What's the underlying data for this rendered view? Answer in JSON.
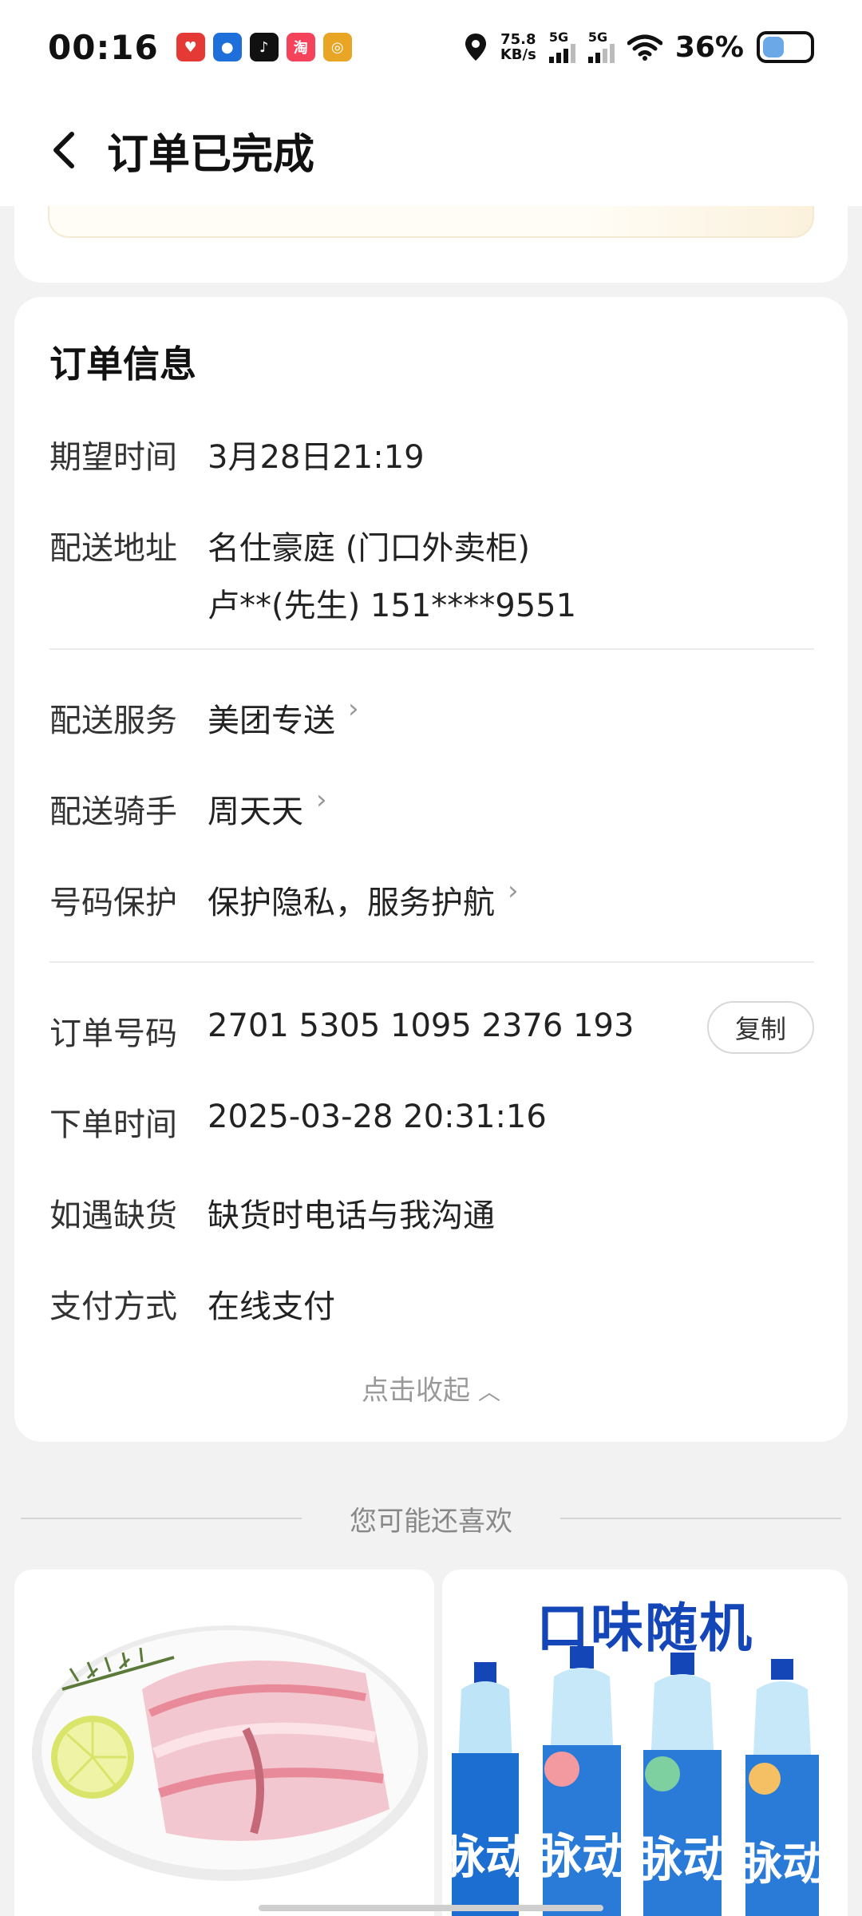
{
  "status_bar": {
    "time": "00:16",
    "speed_value": "75.8",
    "speed_unit": "KB/s",
    "sim1": "5G",
    "sim2": "5G",
    "battery": "36%",
    "app_icons": [
      "shopping-app-icon-1",
      "shopping-app-icon-2",
      "tiktok-icon",
      "taobao-icon",
      "camera-app-icon"
    ]
  },
  "header": {
    "title": "订单已完成"
  },
  "order_info": {
    "title": "订单信息",
    "expected_time": {
      "label": "期望时间",
      "value": "3月28日21:19"
    },
    "address": {
      "label": "配送地址",
      "line1": "名仕豪庭 (门口外卖柜)",
      "line2": "卢**(先生) 151****9551"
    },
    "delivery_service": {
      "label": "配送服务",
      "value": "美团专送"
    },
    "rider": {
      "label": "配送骑手",
      "value": "周天天"
    },
    "number_protection": {
      "label": "号码保护",
      "value": "保护隐私，服务护航"
    },
    "order_number": {
      "label": "订单号码",
      "value": "2701 5305 1095 2376 193",
      "copy_label": "复制"
    },
    "order_time": {
      "label": "下单时间",
      "value": "2025-03-28 20:31:16"
    },
    "out_of_stock": {
      "label": "如遇缺货",
      "value": "缺货时电话与我沟通"
    },
    "payment": {
      "label": "支付方式",
      "value": "在线支付"
    },
    "collapse_label": "点击收起"
  },
  "recommendations": {
    "title": "您可能还喜欢",
    "products": [
      {
        "name": "pork-belly-image"
      },
      {
        "headline": "口味随机",
        "name": "mizone-drinks-image",
        "brand": "脉动"
      }
    ]
  },
  "colors": {
    "accent_blue": "#1546b8",
    "background": "#f2f2f2"
  }
}
